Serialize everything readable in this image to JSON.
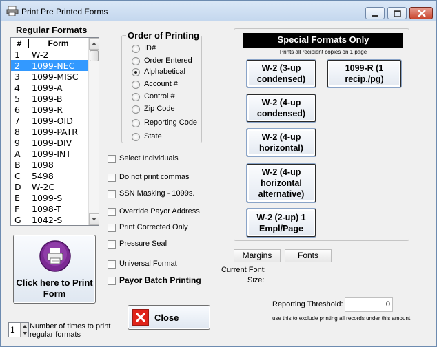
{
  "window": {
    "title": "Print Pre Printed Forms"
  },
  "regular_formats": {
    "title": "Regular Formats",
    "col_hash": "#",
    "col_form": "Form",
    "rows": [
      {
        "id": "1",
        "form": "W-2"
      },
      {
        "id": "2",
        "form": "1099-NEC"
      },
      {
        "id": "3",
        "form": "1099-MISC"
      },
      {
        "id": "4",
        "form": "1099-A"
      },
      {
        "id": "5",
        "form": "1099-B"
      },
      {
        "id": "6",
        "form": "1099-R"
      },
      {
        "id": "7",
        "form": "1099-OID"
      },
      {
        "id": "8",
        "form": "1099-PATR"
      },
      {
        "id": "9",
        "form": "1099-DIV"
      },
      {
        "id": "A",
        "form": "1099-INT"
      },
      {
        "id": "B",
        "form": "1098"
      },
      {
        "id": "C",
        "form": "5498"
      },
      {
        "id": "D",
        "form": "W-2C"
      },
      {
        "id": "E",
        "form": "1099-S"
      },
      {
        "id": "F",
        "form": "1098-T"
      },
      {
        "id": "G",
        "form": "1042-S"
      }
    ],
    "selected_index": 1
  },
  "print_button": {
    "label": "Click here to Print Form"
  },
  "times_spinner": {
    "value": "1",
    "label": "Number of times to print regular formats"
  },
  "order_of_printing": {
    "title": "Order of Printing",
    "options": [
      "ID#",
      "Order Entered",
      "Alphabetical",
      "Account #",
      "Control #",
      "Zip Code",
      "Reporting Code",
      "State"
    ],
    "selected": "Alphabetical"
  },
  "checkboxes": [
    {
      "label": "Select Individuals",
      "checked": false
    },
    {
      "label": "Do not print commas",
      "checked": false
    },
    {
      "label": "SSN Masking - 1099s.",
      "checked": false
    },
    {
      "label": "Override Payor Address",
      "checked": false
    },
    {
      "label": "Print Corrected Only",
      "checked": false
    },
    {
      "label": "Pressure Seal",
      "checked": false
    },
    {
      "label": "Universal Format",
      "checked": false
    },
    {
      "label": "Payor Batch Printing",
      "checked": false
    }
  ],
  "special_formats": {
    "title": "Special Formats Only",
    "subtitle": "Prints all recipient copies on 1 page",
    "buttons": [
      {
        "line1": "W-2 (3-up",
        "line2": "condensed)",
        "line3": ""
      },
      {
        "line1": "1099-R (1",
        "line2": "recip./pg)",
        "line3": ""
      },
      {
        "line1": "W-2 (4-up",
        "line2": "condensed)",
        "line3": ""
      },
      {
        "line1": "W-2 (4-up",
        "line2": "horizontal)",
        "line3": ""
      },
      {
        "line1": "W-2 (4-up",
        "line2": "horizontal",
        "line3": "alternative)"
      },
      {
        "line1": "W-2 (2-up) 1",
        "line2": "Empl/Page",
        "line3": ""
      }
    ]
  },
  "margins_label": "Margins",
  "fonts_label": "Fonts",
  "current_font_label": "Current Font:",
  "size_label": "Size:",
  "close_label": "Close",
  "reporting_threshold": {
    "label": "Reporting Threshold:",
    "value": "0",
    "note": "use this to exclude printing all records under this amount."
  }
}
